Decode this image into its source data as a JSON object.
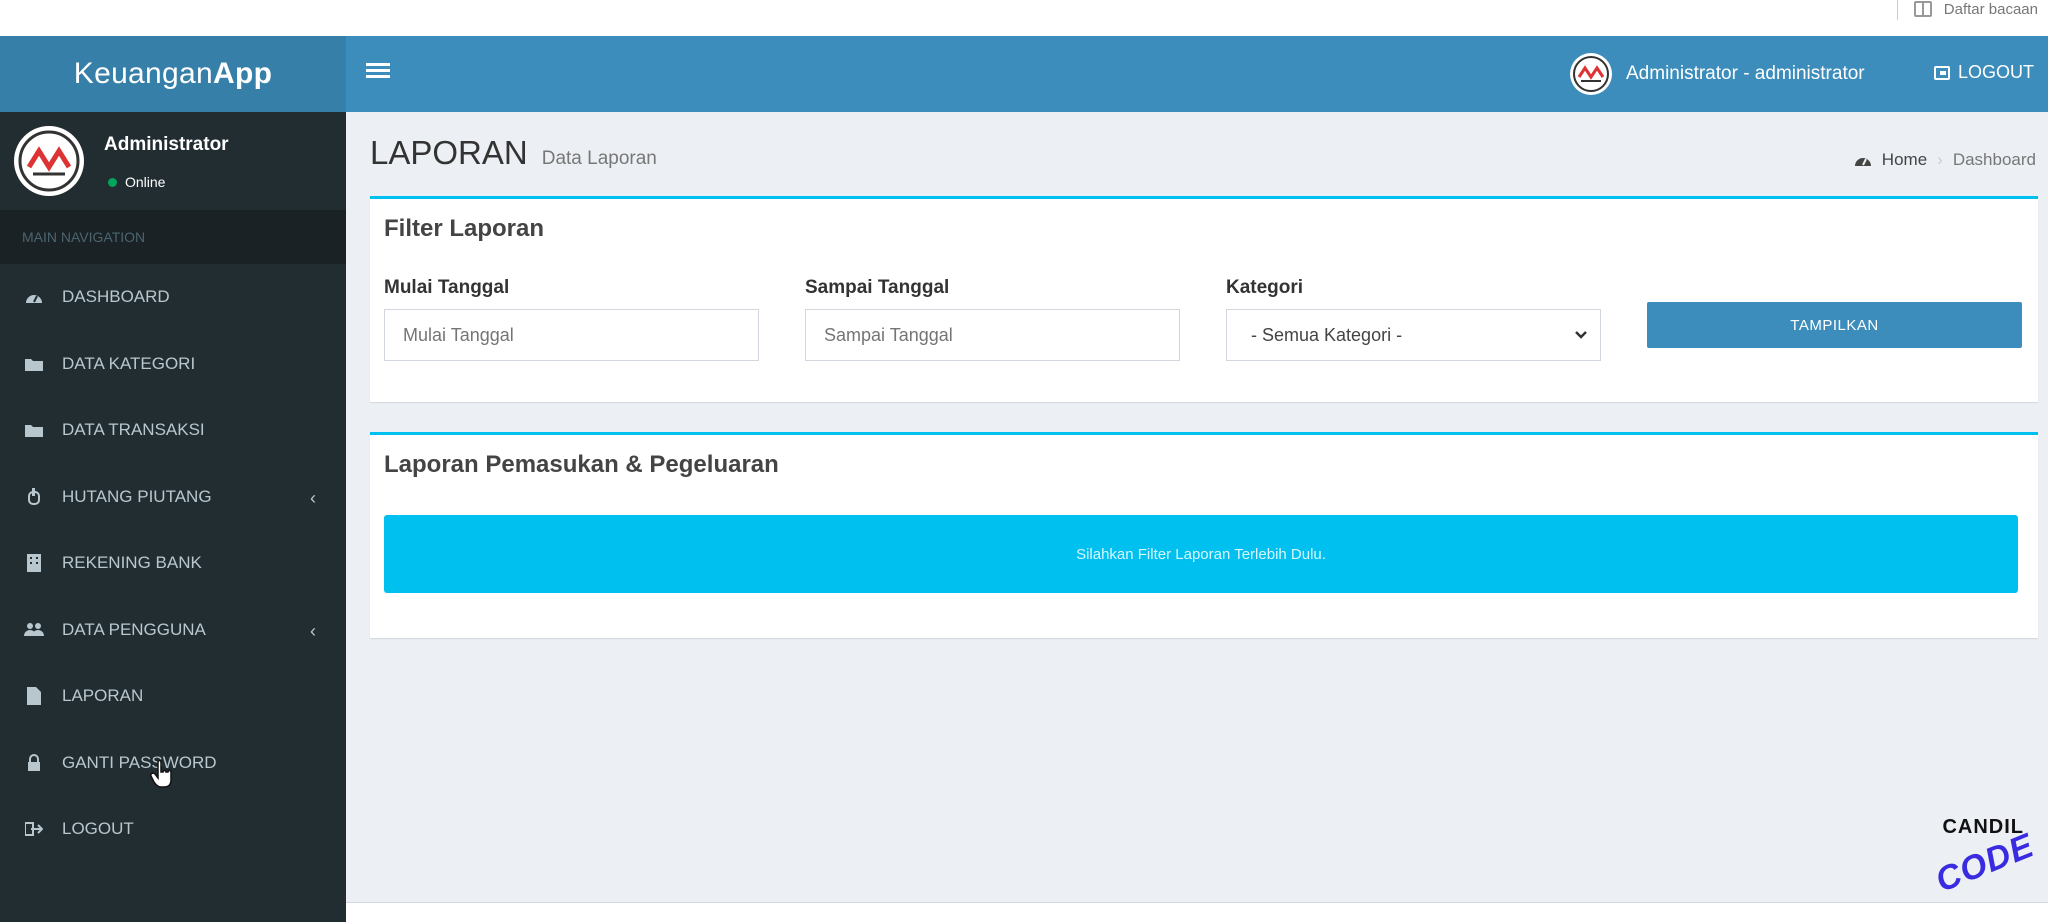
{
  "browser": {
    "reading_list_label": "Daftar bacaan"
  },
  "header": {
    "logo_light": "Keuangan",
    "logo_bold": "App",
    "user_label": "Administrator - administrator",
    "logout_label": "LOGOUT"
  },
  "sidebar": {
    "user_name": "Administrator",
    "user_status": "Online",
    "nav_header": "MAIN NAVIGATION",
    "items": [
      {
        "label": "DASHBOARD",
        "icon": "dashboard-icon"
      },
      {
        "label": "DATA KATEGORI",
        "icon": "folder-icon"
      },
      {
        "label": "DATA TRANSAKSI",
        "icon": "folder-icon"
      },
      {
        "label": "HUTANG PIUTANG",
        "icon": "hand-icon",
        "has_children": true
      },
      {
        "label": "REKENING BANK",
        "icon": "building-icon"
      },
      {
        "label": "DATA PENGGUNA",
        "icon": "users-icon",
        "has_children": true
      },
      {
        "label": "LAPORAN",
        "icon": "file-icon"
      },
      {
        "label": "GANTI PASSWORD",
        "icon": "lock-icon"
      },
      {
        "label": "LOGOUT",
        "icon": "sign-out-icon"
      }
    ]
  },
  "page": {
    "title": "LAPORAN",
    "subtitle": "Data Laporan",
    "breadcrumb": [
      "Home",
      "Dashboard"
    ]
  },
  "filter": {
    "box_title": "Filter Laporan",
    "start_label": "Mulai Tanggal",
    "start_placeholder": "Mulai Tanggal",
    "end_label": "Sampai Tanggal",
    "end_placeholder": "Sampai Tanggal",
    "category_label": "Kategori",
    "category_selected": "- Semua Kategori -",
    "submit_label": "TAMPILKAN"
  },
  "report": {
    "box_title": "Laporan Pemasukan & Pegeluaran",
    "alert_text": "Silahkan Filter Laporan Terlebih Dulu."
  },
  "watermark": {
    "line1": "CANDIL",
    "line2": "CODE"
  },
  "colors": {
    "header": "#3c8dbc",
    "logo_bg": "#367fa9",
    "sidebar": "#222d32",
    "content_bg": "#ecf0f5",
    "box_accent": "#00c0ef",
    "alert_bg": "#00c0ef",
    "online": "#00a65a"
  }
}
